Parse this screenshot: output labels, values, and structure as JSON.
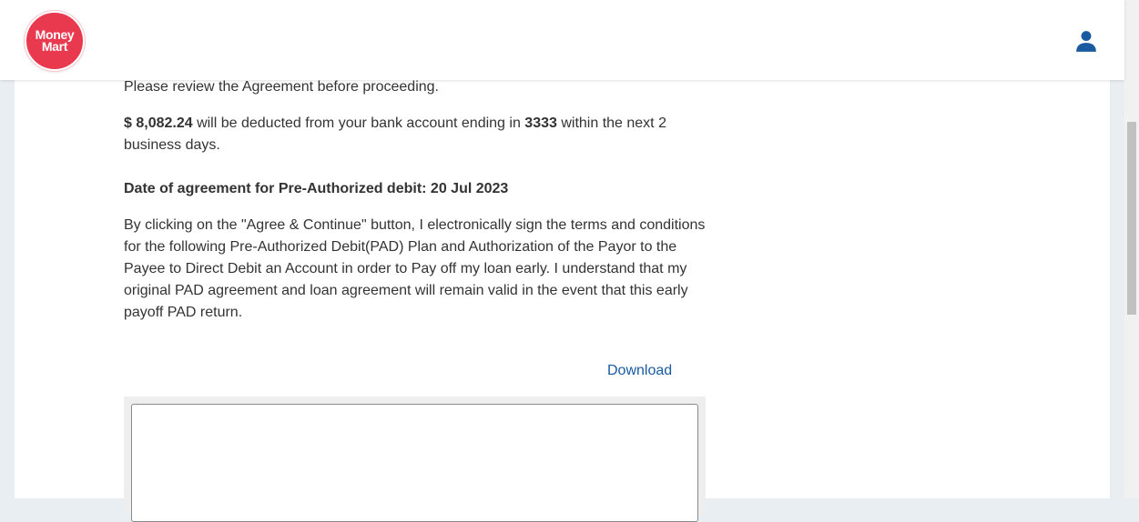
{
  "brand": {
    "line1": "Money",
    "line2": "Mart",
    "color": "#e8394f"
  },
  "header": {
    "user_icon": "user-account-icon",
    "icon_color": "#1a5aa0"
  },
  "agreement": {
    "review_text": "Please review the Agreement before proceeding.",
    "amount": "$ 8,082.24",
    "deduct_mid": " will be deducted from your bank account ending in ",
    "account_ending": "3333",
    "deduct_end": " within the next 2 business days.",
    "date_line": "Date of agreement for Pre-Authorized debit: 20 Jul 2023",
    "legal_text": "By clicking on the \"Agree & Continue\" button, I electronically sign the terms and conditions for the following Pre-Authorized Debit(PAD) Plan and Authorization of the Payor to the Payee to Direct Debit an Account in order to Pay off my loan early. I understand that my original PAD agreement and loan agreement will remain valid in the event that this early payoff PAD return.",
    "download_label": "Download"
  }
}
